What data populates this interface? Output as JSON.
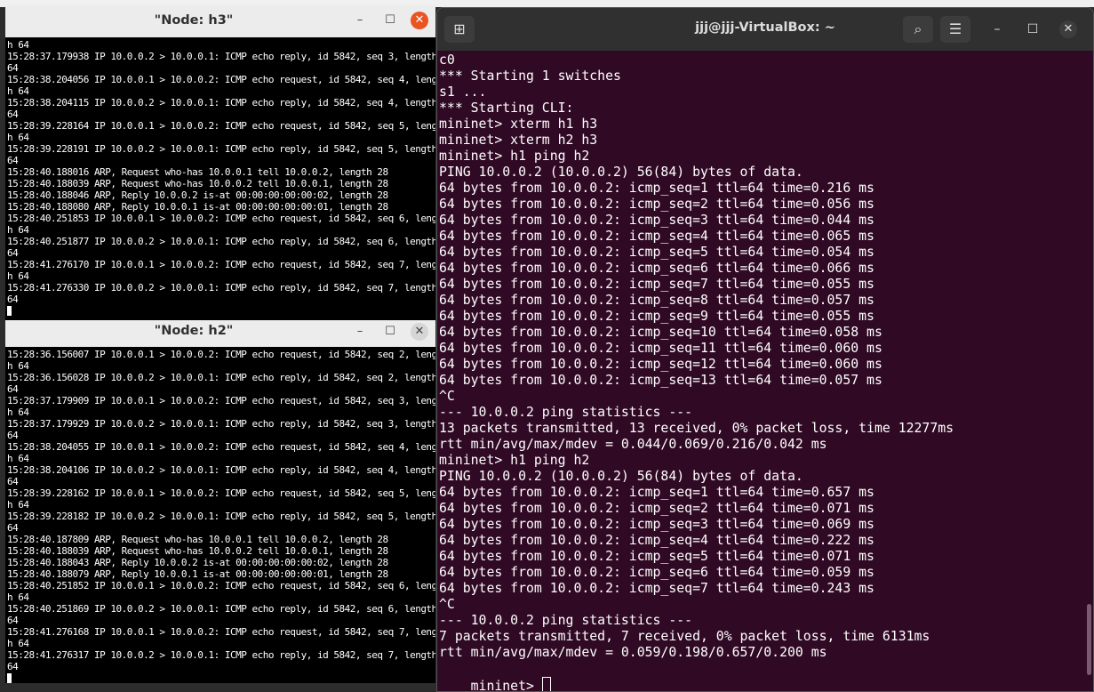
{
  "ubuntu": {
    "title": "jjj@jjj-VirtualBox: ~",
    "new_tab_icon": "new-tab-icon",
    "lines": [
      "c0",
      "*** Starting 1 switches",
      "s1 ...",
      "*** Starting CLI:",
      "mininet> xterm h1 h3",
      "mininet> xterm h2 h3",
      "mininet> h1 ping h2",
      "PING 10.0.0.2 (10.0.0.2) 56(84) bytes of data.",
      "64 bytes from 10.0.0.2: icmp_seq=1 ttl=64 time=0.216 ms",
      "64 bytes from 10.0.0.2: icmp_seq=2 ttl=64 time=0.056 ms",
      "64 bytes from 10.0.0.2: icmp_seq=3 ttl=64 time=0.044 ms",
      "64 bytes from 10.0.0.2: icmp_seq=4 ttl=64 time=0.065 ms",
      "64 bytes from 10.0.0.2: icmp_seq=5 ttl=64 time=0.054 ms",
      "64 bytes from 10.0.0.2: icmp_seq=6 ttl=64 time=0.066 ms",
      "64 bytes from 10.0.0.2: icmp_seq=7 ttl=64 time=0.055 ms",
      "64 bytes from 10.0.0.2: icmp_seq=8 ttl=64 time=0.057 ms",
      "64 bytes from 10.0.0.2: icmp_seq=9 ttl=64 time=0.055 ms",
      "64 bytes from 10.0.0.2: icmp_seq=10 ttl=64 time=0.058 ms",
      "64 bytes from 10.0.0.2: icmp_seq=11 ttl=64 time=0.060 ms",
      "64 bytes from 10.0.0.2: icmp_seq=12 ttl=64 time=0.060 ms",
      "64 bytes from 10.0.0.2: icmp_seq=13 ttl=64 time=0.057 ms",
      "^C",
      "--- 10.0.0.2 ping statistics ---",
      "13 packets transmitted, 13 received, 0% packet loss, time 12277ms",
      "rtt min/avg/max/mdev = 0.044/0.069/0.216/0.042 ms",
      "mininet> h1 ping h2",
      "PING 10.0.0.2 (10.0.0.2) 56(84) bytes of data.",
      "64 bytes from 10.0.0.2: icmp_seq=1 ttl=64 time=0.657 ms",
      "64 bytes from 10.0.0.2: icmp_seq=2 ttl=64 time=0.071 ms",
      "64 bytes from 10.0.0.2: icmp_seq=3 ttl=64 time=0.069 ms",
      "64 bytes from 10.0.0.2: icmp_seq=4 ttl=64 time=0.222 ms",
      "64 bytes from 10.0.0.2: icmp_seq=5 ttl=64 time=0.071 ms",
      "64 bytes from 10.0.0.2: icmp_seq=6 ttl=64 time=0.059 ms",
      "64 bytes from 10.0.0.2: icmp_seq=7 ttl=64 time=0.243 ms",
      "^C",
      "--- 10.0.0.2 ping statistics ---",
      "7 packets transmitted, 7 received, 0% packet loss, time 6131ms",
      "rtt min/avg/max/mdev = 0.059/0.198/0.657/0.200 ms"
    ],
    "prompt": "mininet> "
  },
  "h3": {
    "title": "\"Node: h3\"",
    "lines": [
      "h 64",
      "15:28:37.179938 IP 10.0.0.2 > 10.0.0.1: ICMP echo reply, id 5842, seq 3, length",
      "64",
      "15:28:38.204056 IP 10.0.0.1 > 10.0.0.2: ICMP echo request, id 5842, seq 4, lengt",
      "h 64",
      "15:28:38.204115 IP 10.0.0.2 > 10.0.0.1: ICMP echo reply, id 5842, seq 4, length",
      "64",
      "15:28:39.228164 IP 10.0.0.1 > 10.0.0.2: ICMP echo request, id 5842, seq 5, lengt",
      "h 64",
      "15:28:39.228191 IP 10.0.0.2 > 10.0.0.1: ICMP echo reply, id 5842, seq 5, length",
      "64",
      "15:28:40.188016 ARP, Request who-has 10.0.0.1 tell 10.0.0.2, length 28",
      "15:28:40.188039 ARP, Request who-has 10.0.0.2 tell 10.0.0.1, length 28",
      "15:28:40.188046 ARP, Reply 10.0.0.2 is-at 00:00:00:00:00:02, length 28",
      "15:28:40.188080 ARP, Reply 10.0.0.1 is-at 00:00:00:00:00:01, length 28",
      "15:28:40.251853 IP 10.0.0.1 > 10.0.0.2: ICMP echo request, id 5842, seq 6, lengt",
      "h 64",
      "15:28:40.251877 IP 10.0.0.2 > 10.0.0.1: ICMP echo reply, id 5842, seq 6, length",
      "64",
      "15:28:41.276170 IP 10.0.0.1 > 10.0.0.2: ICMP echo request, id 5842, seq 7, lengt",
      "h 64",
      "15:28:41.276330 IP 10.0.0.2 > 10.0.0.1: ICMP echo reply, id 5842, seq 7, length",
      "64"
    ]
  },
  "h2": {
    "title": "\"Node: h2\"",
    "lines": [
      "15:28:36.156007 IP 10.0.0.1 > 10.0.0.2: ICMP echo request, id 5842, seq 2, lengt",
      "h 64",
      "15:28:36.156028 IP 10.0.0.2 > 10.0.0.1: ICMP echo reply, id 5842, seq 2, length",
      "64",
      "15:28:37.179909 IP 10.0.0.1 > 10.0.0.2: ICMP echo request, id 5842, seq 3, lengt",
      "h 64",
      "15:28:37.179929 IP 10.0.0.2 > 10.0.0.1: ICMP echo reply, id 5842, seq 3, length",
      "64",
      "15:28:38.204055 IP 10.0.0.1 > 10.0.0.2: ICMP echo request, id 5842, seq 4, lengt",
      "h 64",
      "15:28:38.204106 IP 10.0.0.2 > 10.0.0.1: ICMP echo reply, id 5842, seq 4, length",
      "64",
      "15:28:39.228162 IP 10.0.0.1 > 10.0.0.2: ICMP echo request, id 5842, seq 5, lengt",
      "h 64",
      "15:28:39.228182 IP 10.0.0.2 > 10.0.0.1: ICMP echo reply, id 5842, seq 5, length",
      "64",
      "15:28:40.187809 ARP, Request who-has 10.0.0.1 tell 10.0.0.2, length 28",
      "15:28:40.188039 ARP, Request who-has 10.0.0.2 tell 10.0.0.1, length 28",
      "15:28:40.188043 ARP, Reply 10.0.0.2 is-at 00:00:00:00:00:02, length 28",
      "15:28:40.188079 ARP, Reply 10.0.0.1 is-at 00:00:00:00:00:01, length 28",
      "15:28:40.251852 IP 10.0.0.1 > 10.0.0.2: ICMP echo request, id 5842, seq 6, lengt",
      "h 64",
      "15:28:40.251869 IP 10.0.0.2 > 10.0.0.1: ICMP echo reply, id 5842, seq 6, length",
      "64",
      "15:28:41.276168 IP 10.0.0.1 > 10.0.0.2: ICMP echo request, id 5842, seq 7, lengt",
      "h 64",
      "15:28:41.276317 IP 10.0.0.2 > 10.0.0.1: ICMP echo reply, id 5842, seq 7, length",
      "64"
    ]
  },
  "colors": {
    "ubuntu_bg": "#300a24",
    "xterm_bg": "#000000",
    "close_active": "#e95420"
  }
}
